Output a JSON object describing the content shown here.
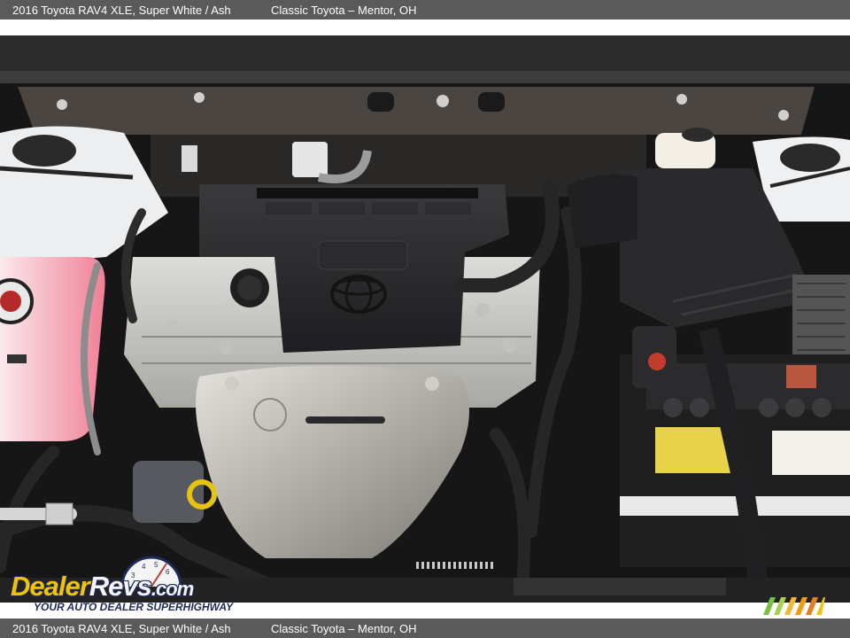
{
  "caption": {
    "vehicle": "2016 Toyota RAV4 XLE,  Super White / Ash",
    "dealer": "Classic Toyota – Mentor, OH"
  },
  "watermark": {
    "brand": "DealerRevs.com",
    "tagline": "Your Auto Dealer SuperHighway"
  },
  "photo": {
    "subject": "engine-bay",
    "colors": {
      "engine_cover": "#2a2a2c",
      "heat_shield": "#b9b7b2",
      "body_paint": "#eef0f2",
      "coolant_tank": "#f2b6c0",
      "battery_label": "#e8d24a",
      "watermark_yellow": "#f2c300",
      "watermark_navy": "#1e2a5a"
    }
  }
}
